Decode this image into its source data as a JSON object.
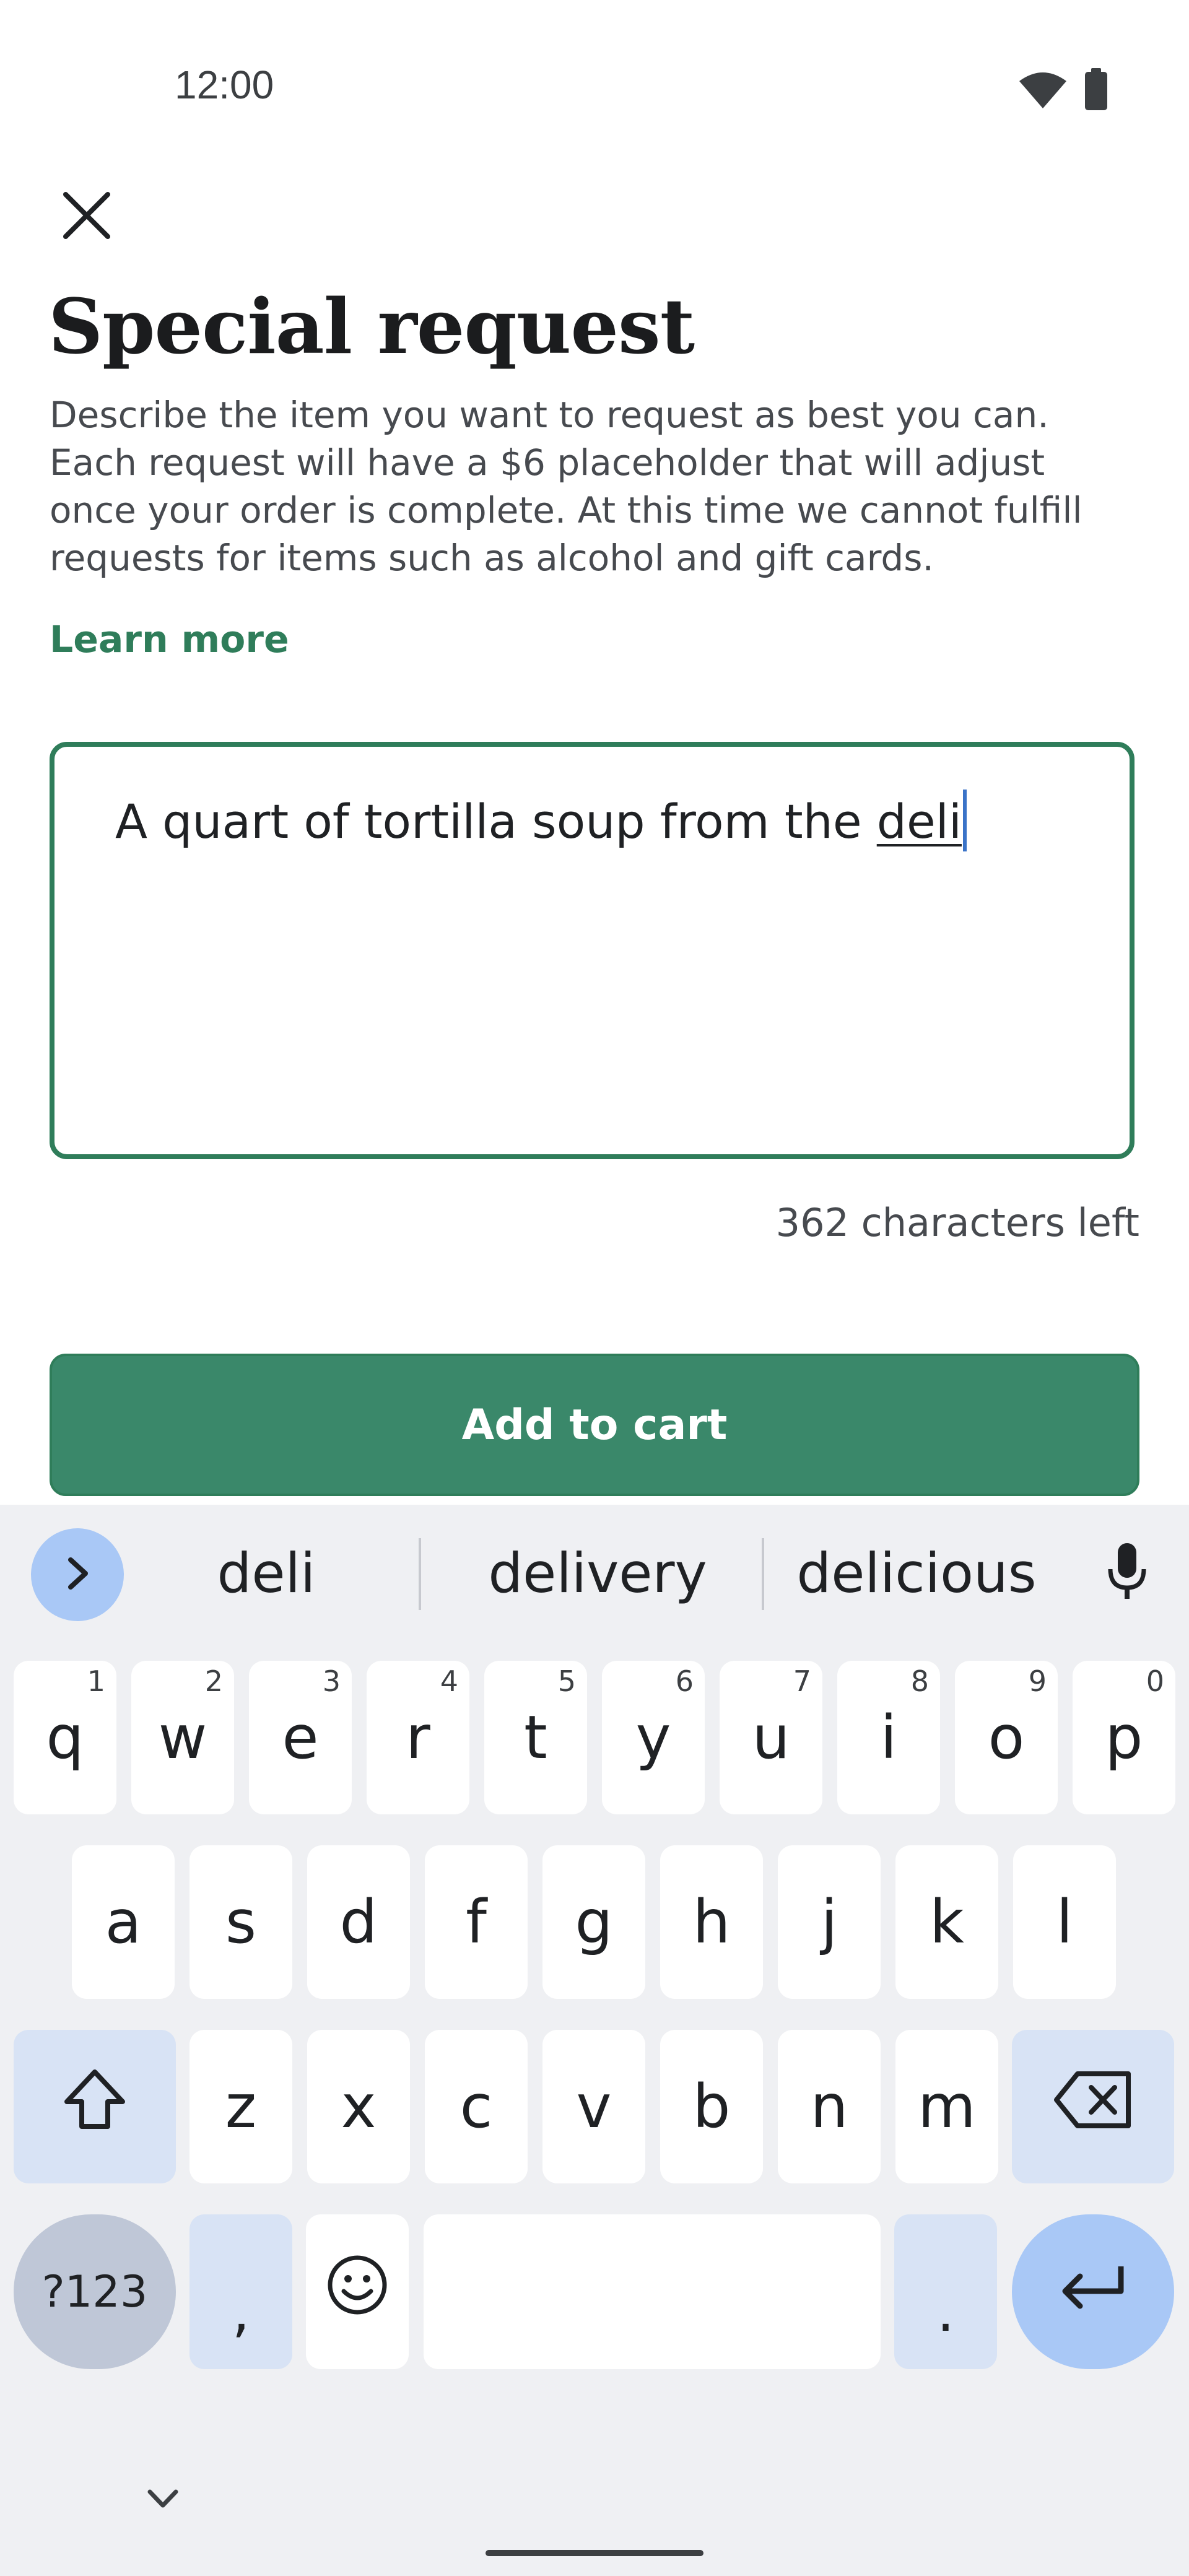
{
  "status": {
    "time": "12:00",
    "icons": [
      "wifi-icon",
      "battery-icon"
    ]
  },
  "header": {
    "close_icon": "close-icon",
    "title": "Special request"
  },
  "description": "Describe the item you want to request as best you can. Each request will have a $6 placeholder that will adjust once your order is complete. At this time we cannot fulfill requests for items such as alcohol and gift cards.",
  "learn_more": "Learn more",
  "request_input": {
    "value_prefix": "A quart of tortilla soup from the ",
    "value_current_word": "deli"
  },
  "counter": "362 characters left",
  "add_button": "Add to cart",
  "colors": {
    "accent": "#2f7d5a",
    "button": "#3a886a",
    "keyboard_bg": "#eff0f3",
    "func_key": "#d8e3f5",
    "enter_key": "#a9c8f6"
  },
  "keyboard": {
    "suggestions": [
      "deli",
      "delivery",
      "delicious"
    ],
    "row1": [
      {
        "k": "q",
        "h": "1"
      },
      {
        "k": "w",
        "h": "2"
      },
      {
        "k": "e",
        "h": "3"
      },
      {
        "k": "r",
        "h": "4"
      },
      {
        "k": "t",
        "h": "5"
      },
      {
        "k": "y",
        "h": "6"
      },
      {
        "k": "u",
        "h": "7"
      },
      {
        "k": "i",
        "h": "8"
      },
      {
        "k": "o",
        "h": "9"
      },
      {
        "k": "p",
        "h": "0"
      }
    ],
    "row2": [
      "a",
      "s",
      "d",
      "f",
      "g",
      "h",
      "j",
      "k",
      "l"
    ],
    "row3": [
      "z",
      "x",
      "c",
      "v",
      "b",
      "n",
      "m"
    ],
    "symbols_key": "?123",
    "comma_key": ",",
    "period_key": "."
  }
}
